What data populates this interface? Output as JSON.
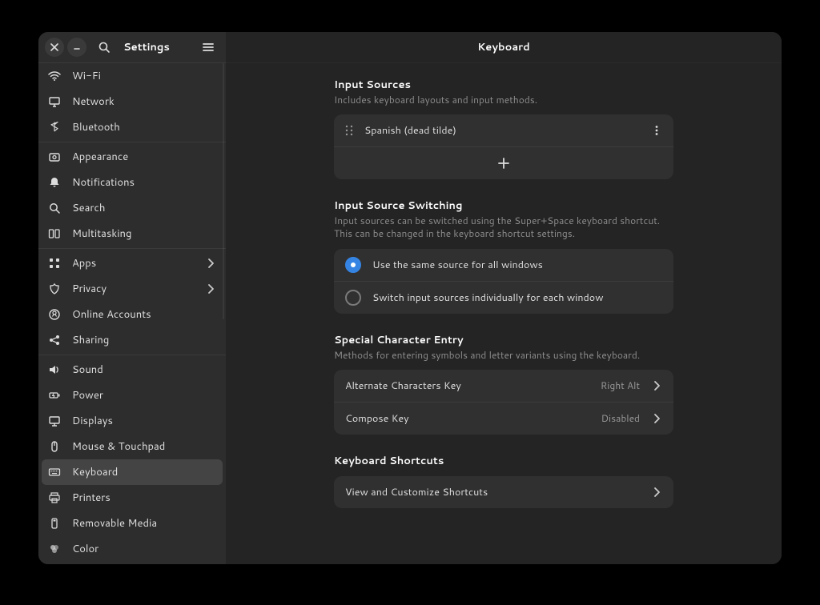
{
  "app_title": "Settings",
  "page_title": "Keyboard",
  "sidebar": {
    "groups": [
      [
        {
          "icon": "wifi",
          "label": "Wi-Fi"
        },
        {
          "icon": "network",
          "label": "Network"
        },
        {
          "icon": "bluetooth",
          "label": "Bluetooth"
        }
      ],
      [
        {
          "icon": "appearance",
          "label": "Appearance"
        },
        {
          "icon": "bell",
          "label": "Notifications"
        },
        {
          "icon": "search",
          "label": "Search"
        },
        {
          "icon": "multitask",
          "label": "Multitasking"
        }
      ],
      [
        {
          "icon": "apps",
          "label": "Apps",
          "chevron": true
        },
        {
          "icon": "privacy",
          "label": "Privacy",
          "chevron": true
        },
        {
          "icon": "accounts",
          "label": "Online Accounts"
        },
        {
          "icon": "sharing",
          "label": "Sharing"
        }
      ],
      [
        {
          "icon": "sound",
          "label": "Sound"
        },
        {
          "icon": "power",
          "label": "Power"
        },
        {
          "icon": "displays",
          "label": "Displays"
        },
        {
          "icon": "mouse",
          "label": "Mouse & Touchpad"
        },
        {
          "icon": "keyboard",
          "label": "Keyboard",
          "active": true
        },
        {
          "icon": "printers",
          "label": "Printers"
        },
        {
          "icon": "removable",
          "label": "Removable Media"
        },
        {
          "icon": "color",
          "label": "Color"
        }
      ]
    ]
  },
  "input_sources": {
    "title": "Input Sources",
    "desc": "Includes keyboard layouts and input methods.",
    "items": [
      "Spanish (dead tilde)"
    ]
  },
  "switching": {
    "title": "Input Source Switching",
    "desc": "Input sources can be switched using the Super+Space keyboard shortcut.\nThis can be changed in the keyboard shortcut settings.",
    "options": [
      {
        "label": "Use the same source for all windows",
        "checked": true
      },
      {
        "label": "Switch input sources individually for each window",
        "checked": false
      }
    ]
  },
  "special": {
    "title": "Special Character Entry",
    "desc": "Methods for entering symbols and letter variants using the keyboard.",
    "rows": [
      {
        "label": "Alternate Characters Key",
        "value": "Right Alt"
      },
      {
        "label": "Compose Key",
        "value": "Disabled"
      }
    ]
  },
  "shortcuts": {
    "title": "Keyboard Shortcuts",
    "row": "View and Customize Shortcuts"
  }
}
